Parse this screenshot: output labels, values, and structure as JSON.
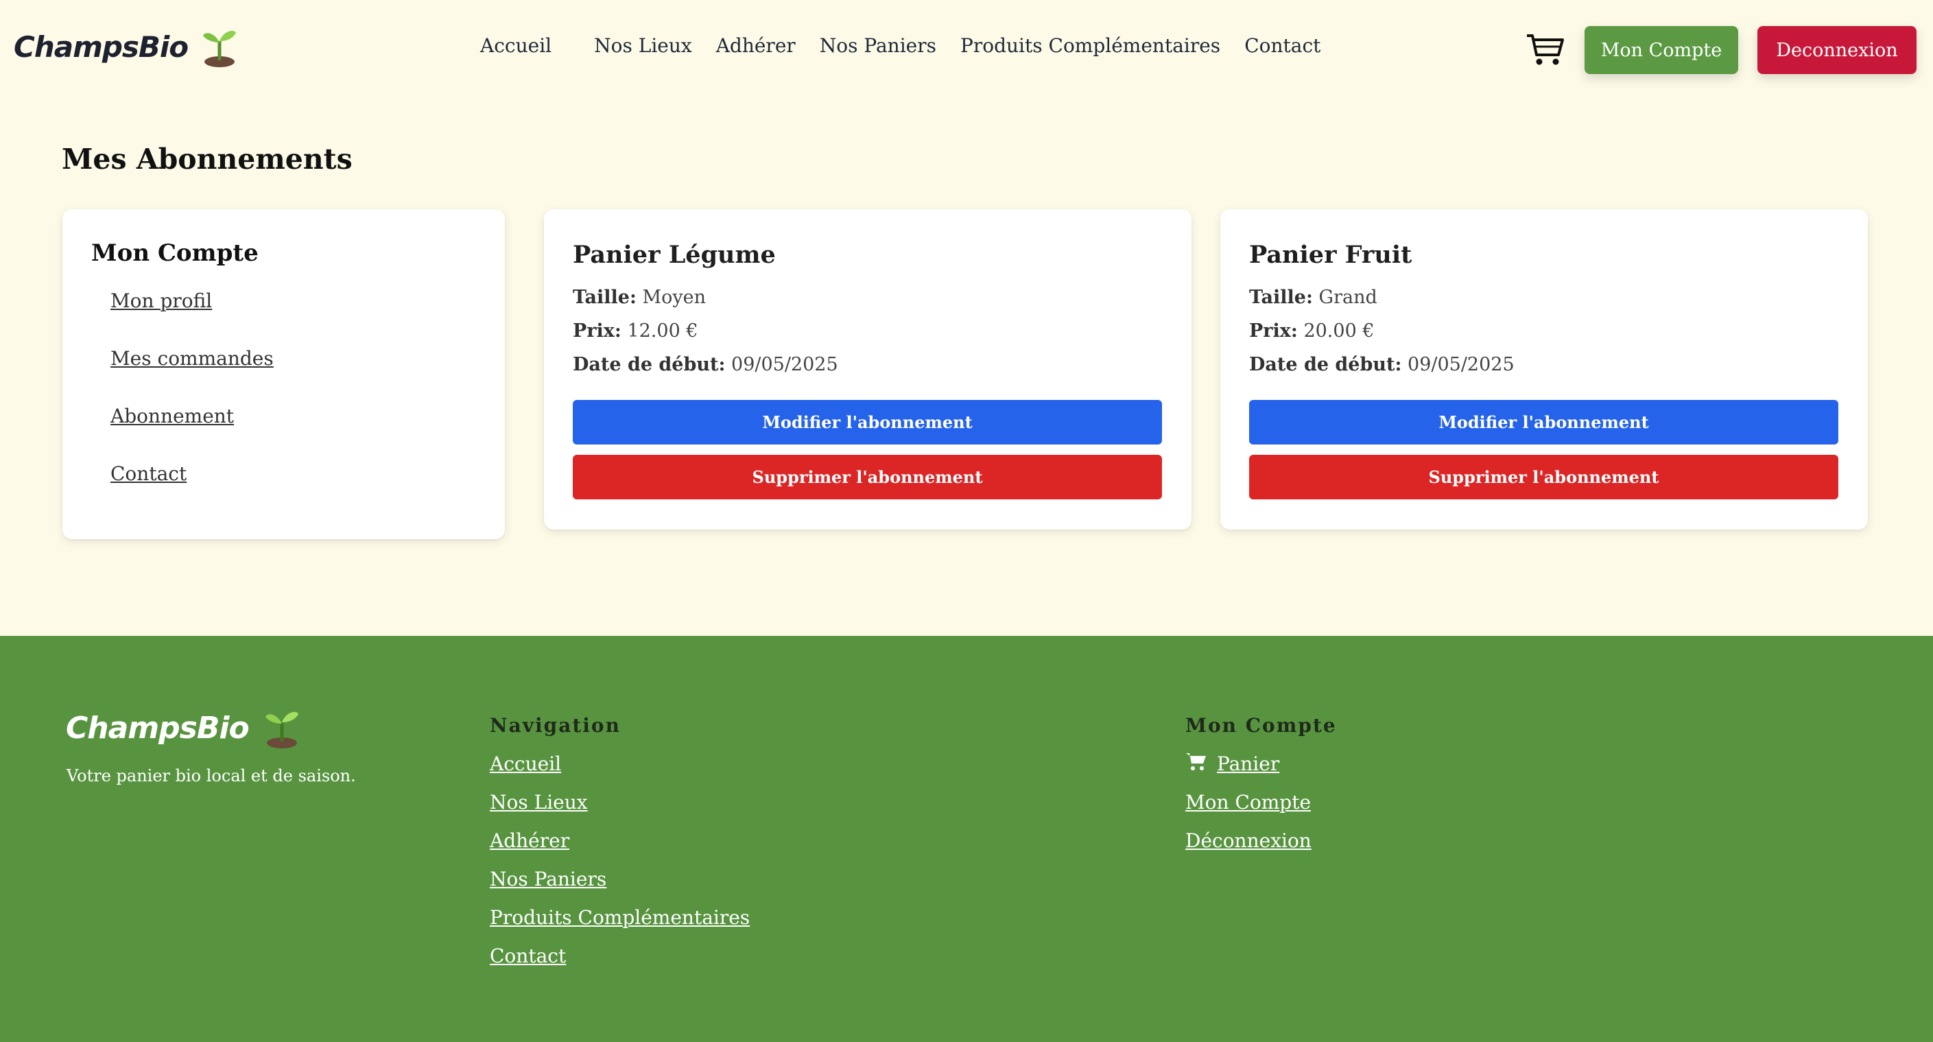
{
  "brand": {
    "name": "ChampsBio"
  },
  "header": {
    "nav": [
      "Accueil",
      "Nos Lieux",
      "Adhérer",
      "Nos Paniers",
      "Produits Complémentaires",
      "Contact"
    ],
    "account_button": "Mon Compte",
    "logout_button": "Deconnexion"
  },
  "main": {
    "title": "Mes Abonnements",
    "sidebar": {
      "title": "Mon Compte",
      "items": [
        "Mon profil",
        "Mes commandes",
        "Abonnement",
        "Contact"
      ]
    },
    "subscriptions": [
      {
        "name": "Panier Légume",
        "size_label": "Taille:",
        "size": "Moyen",
        "price_label": "Prix:",
        "price": "12.00 €",
        "start_label": "Date de début:",
        "start": "09/05/2025",
        "modify": "Modifier l'abonnement",
        "delete": "Supprimer l'abonnement"
      },
      {
        "name": "Panier Fruit",
        "size_label": "Taille:",
        "size": "Grand",
        "price_label": "Prix:",
        "price": "20.00 €",
        "start_label": "Date de début:",
        "start": "09/05/2025",
        "modify": "Modifier l'abonnement",
        "delete": "Supprimer l'abonnement"
      }
    ]
  },
  "footer": {
    "tagline": "Votre panier bio local et de saison.",
    "nav_heading": "Navigation",
    "nav_links": [
      "Accueil",
      "Nos Lieux",
      "Adhérer",
      "Nos Paniers",
      "Produits Complémentaires",
      "Contact"
    ],
    "account_heading": "Mon Compte",
    "account_links": [
      "Panier",
      "Mon Compte",
      "Déconnexion"
    ]
  },
  "colors": {
    "background": "#fdfae8",
    "footer": "#589440",
    "account_button": "#5b9a43",
    "logout_button": "#c8183a",
    "modify_button": "#2563eb",
    "delete_button": "#dc2626"
  },
  "icons": [
    "sprout-icon",
    "cart-icon"
  ]
}
